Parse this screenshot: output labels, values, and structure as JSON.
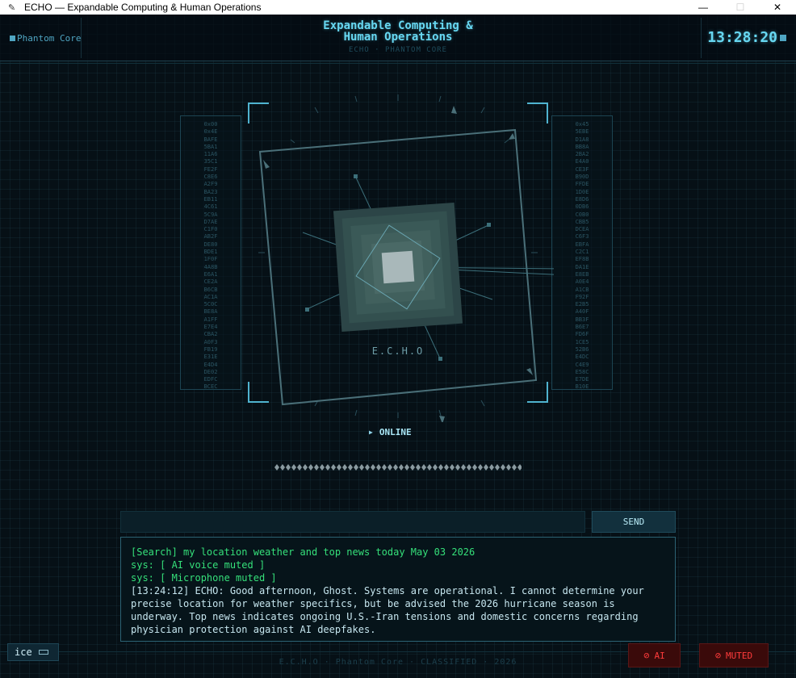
{
  "window": {
    "title": "ECHO — Expandable Computing & Human Operations",
    "min_icon": "—",
    "max_icon": "☐",
    "close_icon": "✕"
  },
  "header": {
    "core_label": "Phantom Core",
    "title_line1": "Expandable Computing &",
    "title_line2": "Human Operations",
    "subtitle": "ECHO  ·  PHANTOM CORE",
    "clock": "13:28:20"
  },
  "core": {
    "label": "E.C.H.O"
  },
  "status": {
    "text": "ONLINE"
  },
  "input": {
    "value": "",
    "placeholder": ""
  },
  "send_label": "SEND",
  "log": [
    {
      "kind": "search",
      "text": "[Search] my location weather and top news today May 03 2026"
    },
    {
      "kind": "sys",
      "text": "sys: [ AI voice muted ]"
    },
    {
      "kind": "sys",
      "text": "sys: [ Microphone muted ]"
    },
    {
      "kind": "echo",
      "text": "[13:24:12] ECHO: Good afternoon, Ghost. Systems are operational. I cannot determine your precise location for weather specifics, but be advised the 2026 hurricane season is underway. Top news indicates ongoing U.S.-Iran tensions and domestic concerns regarding physician protection against AI deepfakes."
    }
  ],
  "footer": {
    "text": "E.C.H.O  ·  Phantom Core  ·  CLASSIFIED  ·  2026"
  },
  "mode_chip": {
    "label": "ice"
  },
  "ai_button": {
    "label": "AI"
  },
  "muted_button": {
    "label": "MUTED"
  },
  "colors": {
    "accent": "#67d8f2",
    "log_green": "#35e07a",
    "alert_red": "#ff3b3b"
  },
  "side_codes": {
    "left": [
      "0x00",
      "0x4E",
      "BAFE",
      "5BA1",
      "11A6",
      "35C1",
      "FE2F",
      "C8E6",
      "A2F9",
      "BA23",
      "EB11",
      "4C61",
      "5C9A",
      "D7AE",
      "C1F0",
      "AB2F",
      "DE80",
      "BDE1",
      "1F0F",
      "4A8B",
      "E6A1",
      "CE2A",
      "B6CB",
      "AC1A",
      "5C0C",
      "BE8A",
      "A1FF",
      "E7E4",
      "CBA2",
      "A0F3",
      "FB19",
      "E31E",
      "E4D4",
      "DE02",
      "EDFC",
      "BCEC"
    ],
    "right": [
      "0x45",
      "5EBE",
      "D1A8",
      "BB8A",
      "2BA2",
      "E4A0",
      "CE3F",
      "B90D",
      "FFDE",
      "1D0E",
      "E8D6",
      "0DB6",
      "C0B0",
      "CBB5",
      "DCEA",
      "C6F3",
      "EBFA",
      "C2C1",
      "EF8B",
      "DA1E",
      "E8EB",
      "A0E4",
      "A1CB",
      "F92F",
      "E2B5",
      "A40F",
      "BB3F",
      "B6E7",
      "FD6F",
      "1CE5",
      "52B6",
      "E4DC",
      "C4E9",
      "E58C",
      "E7DE",
      "B10E"
    ]
  }
}
